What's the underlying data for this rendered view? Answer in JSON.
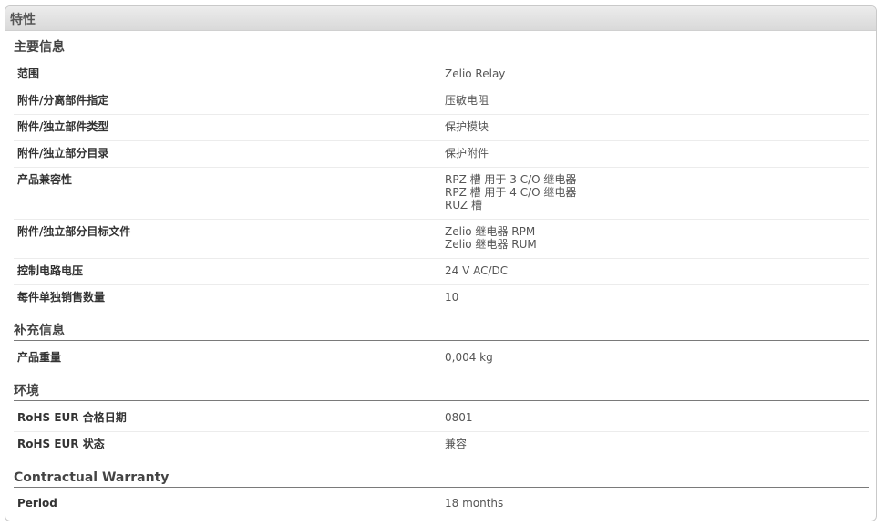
{
  "panel": {
    "title": "特性"
  },
  "sections": {
    "main": {
      "title": "主要信息",
      "rows": [
        {
          "label": "范围",
          "values": [
            "Zelio Relay"
          ]
        },
        {
          "label": "附件/分离部件指定",
          "values": [
            "压敏电阻"
          ]
        },
        {
          "label": "附件/独立部件类型",
          "values": [
            "保护模块"
          ]
        },
        {
          "label": "附件/独立部分目录",
          "values": [
            "保护附件"
          ]
        },
        {
          "label": "产品兼容性",
          "values": [
            "RPZ 槽 用于 3 C/O 继电器",
            "RPZ 槽 用于 4 C/O 继电器",
            "RUZ 槽"
          ]
        },
        {
          "label": "附件/独立部分目标文件",
          "values": [
            "Zelio 继电器 RPM",
            "Zelio 继电器 RUM"
          ]
        },
        {
          "label": "控制电路电压",
          "values": [
            "24 V AC/DC"
          ]
        },
        {
          "label": "每件单独销售数量",
          "values": [
            "10"
          ]
        }
      ]
    },
    "supplementary": {
      "title": "补充信息",
      "rows": [
        {
          "label": "产品重量",
          "values": [
            "0,004 kg"
          ]
        }
      ]
    },
    "environment": {
      "title": "环境",
      "rows": [
        {
          "label": "RoHS EUR 合格日期",
          "values": [
            "0801"
          ]
        },
        {
          "label": "RoHS EUR 状态",
          "values": [
            "兼容"
          ]
        }
      ]
    },
    "warranty": {
      "title": "Contractual Warranty",
      "rows": [
        {
          "label": "Period",
          "values": [
            "18 months"
          ]
        }
      ]
    }
  }
}
